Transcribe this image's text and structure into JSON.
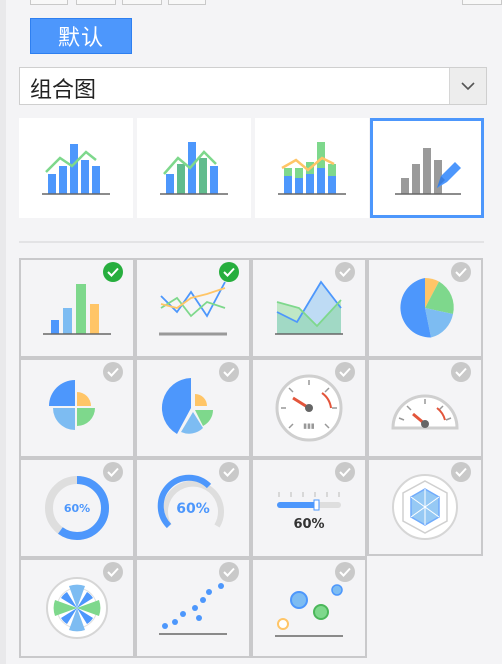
{
  "toolbar": {
    "default_label": "默认"
  },
  "chart_type_select": {
    "value": "组合图",
    "arrow_icon": "chevron-down-icon"
  },
  "subtypes": [
    {
      "name": "bar-line-combo",
      "selected": false
    },
    {
      "name": "stacked-bar-line-combo",
      "selected": false
    },
    {
      "name": "stacked-multi-bar-line-combo",
      "selected": false
    },
    {
      "name": "custom-combo",
      "selected": true
    }
  ],
  "chart_types": [
    {
      "id": "bar",
      "checked": true
    },
    {
      "id": "line",
      "checked": true
    },
    {
      "id": "area",
      "checked": false
    },
    {
      "id": "pie",
      "checked": false
    },
    {
      "id": "rose",
      "checked": false
    },
    {
      "id": "rose-exploded",
      "checked": false
    },
    {
      "id": "gauge",
      "checked": false
    },
    {
      "id": "half-gauge",
      "checked": false
    },
    {
      "id": "ring-progress",
      "checked": false,
      "label": "60%"
    },
    {
      "id": "arc-progress",
      "checked": false,
      "label": "60%"
    },
    {
      "id": "slider-progress",
      "checked": false,
      "label": "60%"
    },
    {
      "id": "radar",
      "checked": false
    },
    {
      "id": "polar",
      "checked": false
    },
    {
      "id": "scatter",
      "checked": false
    },
    {
      "id": "bubble",
      "checked": false
    }
  ],
  "colors": {
    "accent": "#4d97fc",
    "green": "#7ed88c",
    "orange": "#ffc567",
    "light_blue": "#7dbcf2",
    "check_on": "#27ae3e",
    "check_off": "#c9c9c9"
  }
}
